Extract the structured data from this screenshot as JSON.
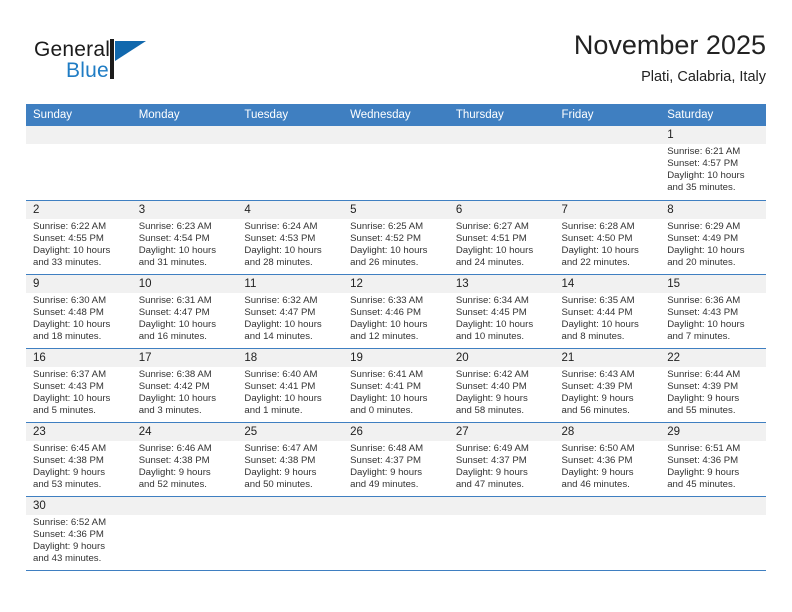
{
  "brand": {
    "name_top": "General",
    "name_bottom": "Blue",
    "mark_icon": "triangle-flag-icon",
    "color_blue": "#1f7cc4",
    "color_mark": "#1168ad"
  },
  "header": {
    "month_title": "November 2025",
    "location": "Plati, Calabria, Italy"
  },
  "theme": {
    "header_row_bg": "#3f7fc1",
    "daynum_bg": "#f1f1f1",
    "grid_line": "#3f7fc1",
    "text": "#222222"
  },
  "calendar": {
    "weekday_headers": [
      "Sunday",
      "Monday",
      "Tuesday",
      "Wednesday",
      "Thursday",
      "Friday",
      "Saturday"
    ],
    "weeks": [
      [
        {
          "blank": true
        },
        {
          "blank": true
        },
        {
          "blank": true
        },
        {
          "blank": true
        },
        {
          "blank": true
        },
        {
          "blank": true
        },
        {
          "day": "1",
          "sunrise": "Sunrise: 6:21 AM",
          "sunset": "Sunset: 4:57 PM",
          "daylight1": "Daylight: 10 hours",
          "daylight2": "and 35 minutes."
        }
      ],
      [
        {
          "day": "2",
          "sunrise": "Sunrise: 6:22 AM",
          "sunset": "Sunset: 4:55 PM",
          "daylight1": "Daylight: 10 hours",
          "daylight2": "and 33 minutes."
        },
        {
          "day": "3",
          "sunrise": "Sunrise: 6:23 AM",
          "sunset": "Sunset: 4:54 PM",
          "daylight1": "Daylight: 10 hours",
          "daylight2": "and 31 minutes."
        },
        {
          "day": "4",
          "sunrise": "Sunrise: 6:24 AM",
          "sunset": "Sunset: 4:53 PM",
          "daylight1": "Daylight: 10 hours",
          "daylight2": "and 28 minutes."
        },
        {
          "day": "5",
          "sunrise": "Sunrise: 6:25 AM",
          "sunset": "Sunset: 4:52 PM",
          "daylight1": "Daylight: 10 hours",
          "daylight2": "and 26 minutes."
        },
        {
          "day": "6",
          "sunrise": "Sunrise: 6:27 AM",
          "sunset": "Sunset: 4:51 PM",
          "daylight1": "Daylight: 10 hours",
          "daylight2": "and 24 minutes."
        },
        {
          "day": "7",
          "sunrise": "Sunrise: 6:28 AM",
          "sunset": "Sunset: 4:50 PM",
          "daylight1": "Daylight: 10 hours",
          "daylight2": "and 22 minutes."
        },
        {
          "day": "8",
          "sunrise": "Sunrise: 6:29 AM",
          "sunset": "Sunset: 4:49 PM",
          "daylight1": "Daylight: 10 hours",
          "daylight2": "and 20 minutes."
        }
      ],
      [
        {
          "day": "9",
          "sunrise": "Sunrise: 6:30 AM",
          "sunset": "Sunset: 4:48 PM",
          "daylight1": "Daylight: 10 hours",
          "daylight2": "and 18 minutes."
        },
        {
          "day": "10",
          "sunrise": "Sunrise: 6:31 AM",
          "sunset": "Sunset: 4:47 PM",
          "daylight1": "Daylight: 10 hours",
          "daylight2": "and 16 minutes."
        },
        {
          "day": "11",
          "sunrise": "Sunrise: 6:32 AM",
          "sunset": "Sunset: 4:47 PM",
          "daylight1": "Daylight: 10 hours",
          "daylight2": "and 14 minutes."
        },
        {
          "day": "12",
          "sunrise": "Sunrise: 6:33 AM",
          "sunset": "Sunset: 4:46 PM",
          "daylight1": "Daylight: 10 hours",
          "daylight2": "and 12 minutes."
        },
        {
          "day": "13",
          "sunrise": "Sunrise: 6:34 AM",
          "sunset": "Sunset: 4:45 PM",
          "daylight1": "Daylight: 10 hours",
          "daylight2": "and 10 minutes."
        },
        {
          "day": "14",
          "sunrise": "Sunrise: 6:35 AM",
          "sunset": "Sunset: 4:44 PM",
          "daylight1": "Daylight: 10 hours",
          "daylight2": "and 8 minutes."
        },
        {
          "day": "15",
          "sunrise": "Sunrise: 6:36 AM",
          "sunset": "Sunset: 4:43 PM",
          "daylight1": "Daylight: 10 hours",
          "daylight2": "and 7 minutes."
        }
      ],
      [
        {
          "day": "16",
          "sunrise": "Sunrise: 6:37 AM",
          "sunset": "Sunset: 4:43 PM",
          "daylight1": "Daylight: 10 hours",
          "daylight2": "and 5 minutes."
        },
        {
          "day": "17",
          "sunrise": "Sunrise: 6:38 AM",
          "sunset": "Sunset: 4:42 PM",
          "daylight1": "Daylight: 10 hours",
          "daylight2": "and 3 minutes."
        },
        {
          "day": "18",
          "sunrise": "Sunrise: 6:40 AM",
          "sunset": "Sunset: 4:41 PM",
          "daylight1": "Daylight: 10 hours",
          "daylight2": "and 1 minute."
        },
        {
          "day": "19",
          "sunrise": "Sunrise: 6:41 AM",
          "sunset": "Sunset: 4:41 PM",
          "daylight1": "Daylight: 10 hours",
          "daylight2": "and 0 minutes."
        },
        {
          "day": "20",
          "sunrise": "Sunrise: 6:42 AM",
          "sunset": "Sunset: 4:40 PM",
          "daylight1": "Daylight: 9 hours",
          "daylight2": "and 58 minutes."
        },
        {
          "day": "21",
          "sunrise": "Sunrise: 6:43 AM",
          "sunset": "Sunset: 4:39 PM",
          "daylight1": "Daylight: 9 hours",
          "daylight2": "and 56 minutes."
        },
        {
          "day": "22",
          "sunrise": "Sunrise: 6:44 AM",
          "sunset": "Sunset: 4:39 PM",
          "daylight1": "Daylight: 9 hours",
          "daylight2": "and 55 minutes."
        }
      ],
      [
        {
          "day": "23",
          "sunrise": "Sunrise: 6:45 AM",
          "sunset": "Sunset: 4:38 PM",
          "daylight1": "Daylight: 9 hours",
          "daylight2": "and 53 minutes."
        },
        {
          "day": "24",
          "sunrise": "Sunrise: 6:46 AM",
          "sunset": "Sunset: 4:38 PM",
          "daylight1": "Daylight: 9 hours",
          "daylight2": "and 52 minutes."
        },
        {
          "day": "25",
          "sunrise": "Sunrise: 6:47 AM",
          "sunset": "Sunset: 4:38 PM",
          "daylight1": "Daylight: 9 hours",
          "daylight2": "and 50 minutes."
        },
        {
          "day": "26",
          "sunrise": "Sunrise: 6:48 AM",
          "sunset": "Sunset: 4:37 PM",
          "daylight1": "Daylight: 9 hours",
          "daylight2": "and 49 minutes."
        },
        {
          "day": "27",
          "sunrise": "Sunrise: 6:49 AM",
          "sunset": "Sunset: 4:37 PM",
          "daylight1": "Daylight: 9 hours",
          "daylight2": "and 47 minutes."
        },
        {
          "day": "28",
          "sunrise": "Sunrise: 6:50 AM",
          "sunset": "Sunset: 4:36 PM",
          "daylight1": "Daylight: 9 hours",
          "daylight2": "and 46 minutes."
        },
        {
          "day": "29",
          "sunrise": "Sunrise: 6:51 AM",
          "sunset": "Sunset: 4:36 PM",
          "daylight1": "Daylight: 9 hours",
          "daylight2": "and 45 minutes."
        }
      ],
      [
        {
          "day": "30",
          "sunrise": "Sunrise: 6:52 AM",
          "sunset": "Sunset: 4:36 PM",
          "daylight1": "Daylight: 9 hours",
          "daylight2": "and 43 minutes."
        },
        {
          "blank": true
        },
        {
          "blank": true
        },
        {
          "blank": true
        },
        {
          "blank": true
        },
        {
          "blank": true
        },
        {
          "blank": true
        }
      ]
    ]
  }
}
